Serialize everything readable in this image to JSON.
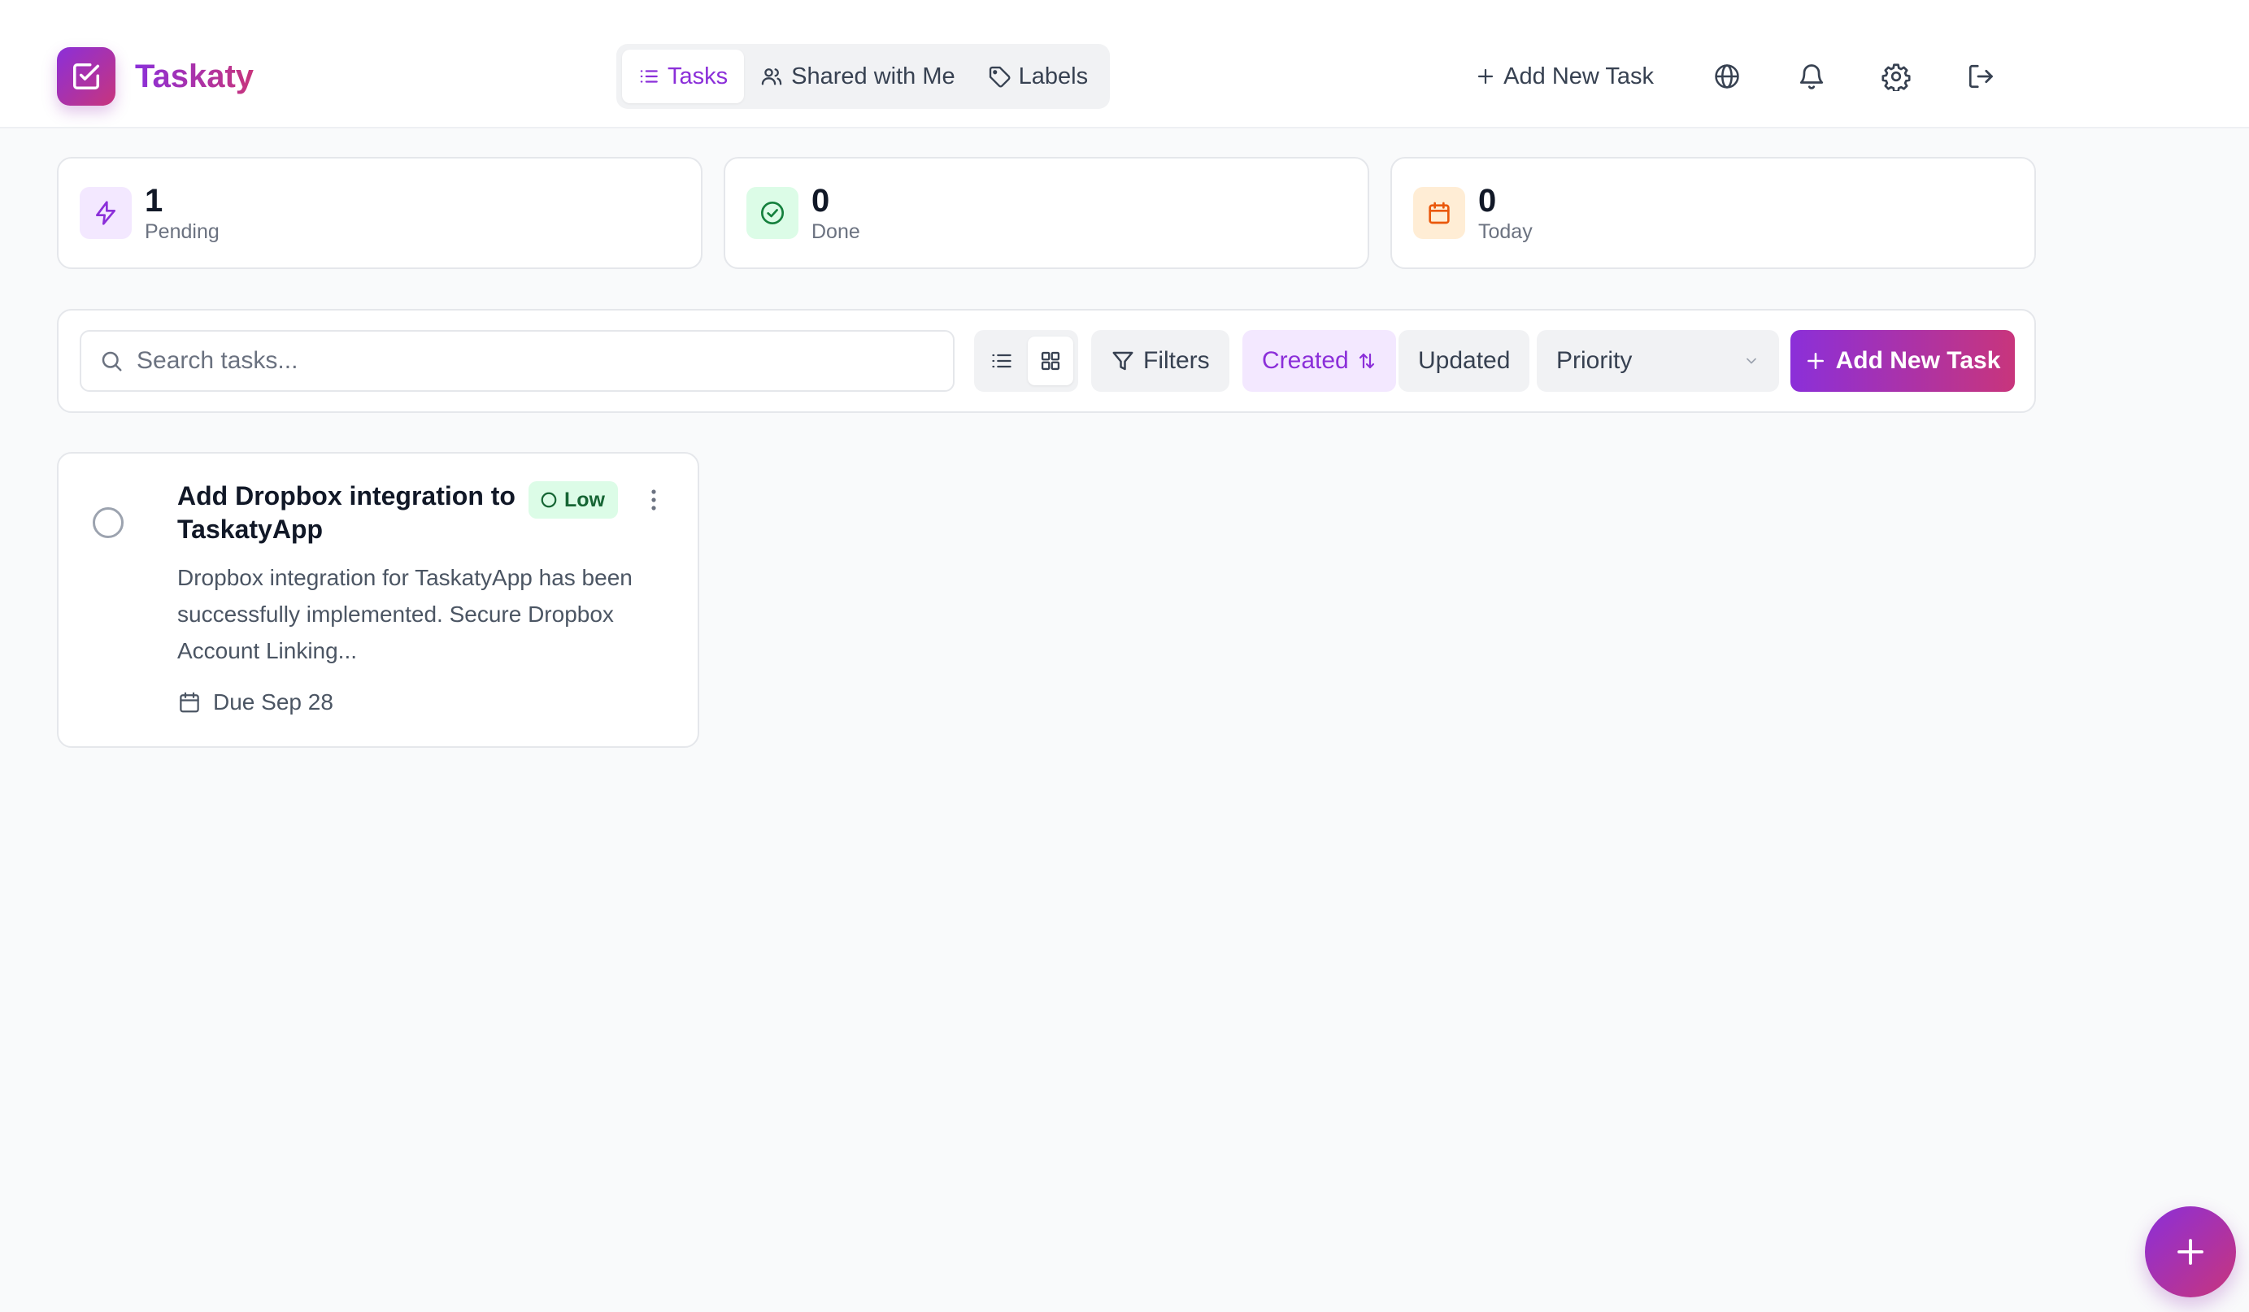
{
  "app": {
    "name": "Taskaty"
  },
  "colors": {
    "accent": "#8b2fd9",
    "accent_end": "#c8357c",
    "low_priority": "#166534"
  },
  "nav": {
    "tabs": [
      {
        "label": "Tasks",
        "icon": "list-icon",
        "active": true
      },
      {
        "label": "Shared with Me",
        "icon": "users-icon",
        "active": false
      },
      {
        "label": "Labels",
        "icon": "tag-icon",
        "active": false
      }
    ]
  },
  "header": {
    "add_task_label": "Add New Task",
    "icons": [
      "globe-icon",
      "bell-icon",
      "gear-icon",
      "logout-icon"
    ]
  },
  "stats": [
    {
      "value": "1",
      "label": "Pending",
      "icon": "lightning-icon"
    },
    {
      "value": "0",
      "label": "Done",
      "icon": "check-circle-icon"
    },
    {
      "value": "0",
      "label": "Today",
      "icon": "calendar-icon"
    }
  ],
  "toolbar": {
    "search_placeholder": "Search tasks...",
    "view_mode": "grid",
    "filters_label": "Filters",
    "sort_created_label": "Created",
    "sort_updated_label": "Updated",
    "priority_label": "Priority",
    "add_task_label": "Add New Task"
  },
  "tasks": [
    {
      "title": "Add Dropbox integration to TaskatyApp",
      "priority": "Low",
      "description": "Dropbox integration for TaskatyApp has been successfully implemented. Secure Dropbox Account Linking...",
      "due": "Due Sep 28",
      "completed": false
    }
  ]
}
